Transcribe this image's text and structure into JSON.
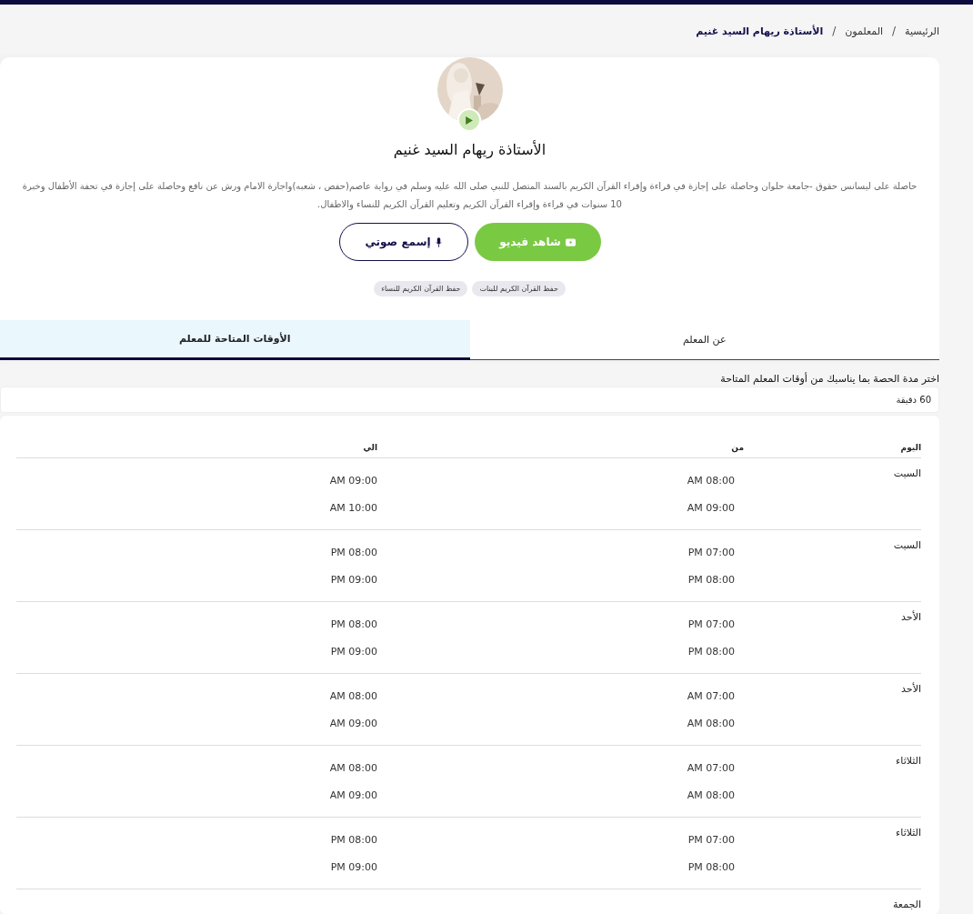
{
  "breadcrumb_separator": "/",
  "breadcrumb": [
    {
      "label": "الرئيسية",
      "current": false
    },
    {
      "label": "المعلمون",
      "current": false
    },
    {
      "label": "الأستاذة ريهام السيد غنيم",
      "current": true
    }
  ],
  "profile": {
    "name": "الأستاذة ريهام السيد غنيم",
    "bio": "حاصلة على ليسانس حقوق -جامعة حلوان وحاصلة على إجازة في قراءة وإقراء القرآن الكريم بالسند المتصل للنبي صلى الله عليه وسلم في رواية عاصم(حفص ، شعبه)واجازة الامام ورش عن نافع وحاصلة على إجازة في تحفة الأطفال وخبرة 10 سنوات في قراءة وإقراء القرآن الكريم وتعليم القرآن الكريم للنساء والاطفال.",
    "buttons": [
      {
        "label": "شاهد فيديو",
        "kind": "video"
      },
      {
        "label": "إسمع صوتي",
        "kind": "audio"
      }
    ],
    "tags": [
      "حفظ القرآن الكريم للبنات",
      "حفظ القرآن الكريم للنساء"
    ]
  },
  "tabs": [
    {
      "label": "عن المعلم",
      "selected": false
    },
    {
      "label": "الأوقات المتاحة للمعلم",
      "selected": true
    }
  ],
  "duration": {
    "label": "اختر مدة الحصة بما يناسبك من أوقات المعلم المتاحة",
    "value": "60 دقيقة"
  },
  "table": {
    "columns": [
      "اليوم",
      "من",
      "الي"
    ],
    "rows": [
      {
        "day": "السبت",
        "slots": [
          {
            "from": "AM 08:00",
            "to": "AM 09:00"
          },
          {
            "from": "AM 09:00",
            "to": "AM 10:00"
          }
        ]
      },
      {
        "day": "السبت",
        "slots": [
          {
            "from": "PM 07:00",
            "to": "PM 08:00"
          },
          {
            "from": "PM 08:00",
            "to": "PM 09:00"
          }
        ]
      },
      {
        "day": "الأحد",
        "slots": [
          {
            "from": "PM 07:00",
            "to": "PM 08:00"
          },
          {
            "from": "PM 08:00",
            "to": "PM 09:00"
          }
        ]
      },
      {
        "day": "الأحد",
        "slots": [
          {
            "from": "AM 07:00",
            "to": "AM 08:00"
          },
          {
            "from": "AM 08:00",
            "to": "AM 09:00"
          }
        ]
      },
      {
        "day": "الثلاثاء",
        "slots": [
          {
            "from": "AM 07:00",
            "to": "AM 08:00"
          },
          {
            "from": "AM 08:00",
            "to": "AM 09:00"
          }
        ]
      },
      {
        "day": "الثلاثاء",
        "slots": [
          {
            "from": "PM 07:00",
            "to": "PM 08:00"
          },
          {
            "from": "PM 08:00",
            "to": "PM 09:00"
          }
        ]
      },
      {
        "day": "الجمعة",
        "slots": []
      }
    ]
  }
}
